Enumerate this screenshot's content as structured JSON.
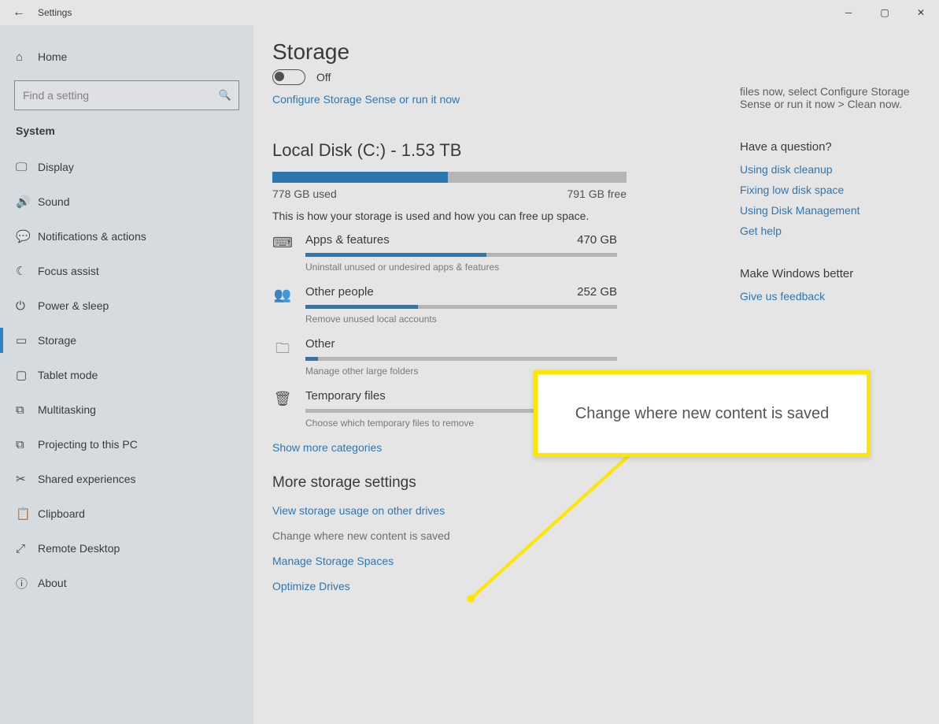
{
  "window": {
    "title": "Settings"
  },
  "nav": {
    "home_label": "Home",
    "search_placeholder": "Find a setting",
    "group_label": "System",
    "items": [
      {
        "label": "Display"
      },
      {
        "label": "Sound"
      },
      {
        "label": "Notifications & actions"
      },
      {
        "label": "Focus assist"
      },
      {
        "label": "Power & sleep"
      },
      {
        "label": "Storage"
      },
      {
        "label": "Tablet mode"
      },
      {
        "label": "Multitasking"
      },
      {
        "label": "Projecting to this PC"
      },
      {
        "label": "Shared experiences"
      },
      {
        "label": "Clipboard"
      },
      {
        "label": "Remote Desktop"
      },
      {
        "label": "About"
      }
    ]
  },
  "page": {
    "title": "Storage",
    "sense": {
      "state": "Off",
      "configure_link": "Configure Storage Sense or run it now"
    },
    "disk": {
      "title": "Local Disk (C:) - 1.53 TB",
      "used_label": "778 GB used",
      "free_label": "791 GB free",
      "used_pct": 49.5,
      "desc": "This is how your storage is used and how you can free up space."
    },
    "categories": [
      {
        "name": "Apps & features",
        "size": "470 GB",
        "pct": 58,
        "hint": "Uninstall unused or undesired apps & features",
        "icon": "⌨"
      },
      {
        "name": "Other people",
        "size": "252 GB",
        "pct": 36,
        "hint": "Remove unused local accounts",
        "icon": "👥"
      },
      {
        "name": "Other",
        "size": "",
        "pct": 4,
        "hint": "Manage other large folders",
        "icon": "🗀"
      },
      {
        "name": "Temporary files",
        "size": "",
        "pct": 0,
        "hint": "Choose which temporary files to remove",
        "icon": "🗑"
      }
    ],
    "show_more": "Show more categories",
    "more": {
      "heading": "More storage settings",
      "links": [
        "View storage usage on other drives",
        "Change where new content is saved",
        "Manage Storage Spaces",
        "Optimize Drives"
      ]
    }
  },
  "rpanel": {
    "hint_text": "files now, select Configure Storage Sense or run it now > Clean now.",
    "q_head": "Have a question?",
    "q_links": [
      "Using disk cleanup",
      "Fixing low disk space",
      "Using Disk Management",
      "Get help"
    ],
    "fb_head": "Make Windows better",
    "fb_link": "Give us feedback"
  },
  "callout": {
    "text": "Change where new content is saved"
  }
}
